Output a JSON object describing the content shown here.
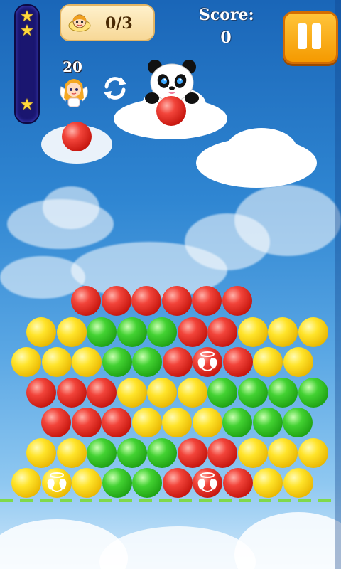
{
  "hud": {
    "goal_count": "0/3",
    "score_label": "Score:",
    "score_value": "0",
    "shots_left": "20",
    "stars_earned": 3,
    "pause_icon": "pause-icon",
    "swap_icon": "swap-icon"
  },
  "launcher": {
    "current_ball": "red",
    "next_ball": "red",
    "character": "panda"
  },
  "board": {
    "rows": [
      [
        "red",
        "red",
        "red",
        "red",
        "red",
        "red"
      ],
      [
        "yellow",
        "yellow",
        "green",
        "green",
        "green",
        "red",
        "red",
        "yellow",
        "yellow",
        "yellow"
      ],
      [
        "yellow",
        "yellow",
        "yellow",
        "green",
        "green",
        "red",
        "angel-red",
        "red",
        "yellow",
        "yellow"
      ],
      [
        "red",
        "red",
        "red",
        "yellow",
        "yellow",
        "yellow",
        "green",
        "green",
        "green",
        "green"
      ],
      [
        "red",
        "red",
        "red",
        "yellow",
        "yellow",
        "yellow",
        "green",
        "green",
        "green"
      ],
      [
        "yellow",
        "yellow",
        "green",
        "green",
        "green",
        "red",
        "red",
        "yellow",
        "yellow",
        "yellow"
      ],
      [
        "yellow",
        "angel-yellow",
        "yellow",
        "green",
        "green",
        "red",
        "angel-red",
        "red",
        "yellow",
        "yellow"
      ]
    ]
  },
  "colors": {
    "red": "#e0261c",
    "yellow": "#ffd600",
    "green": "#2fbd22",
    "pause": "#f5a300"
  }
}
